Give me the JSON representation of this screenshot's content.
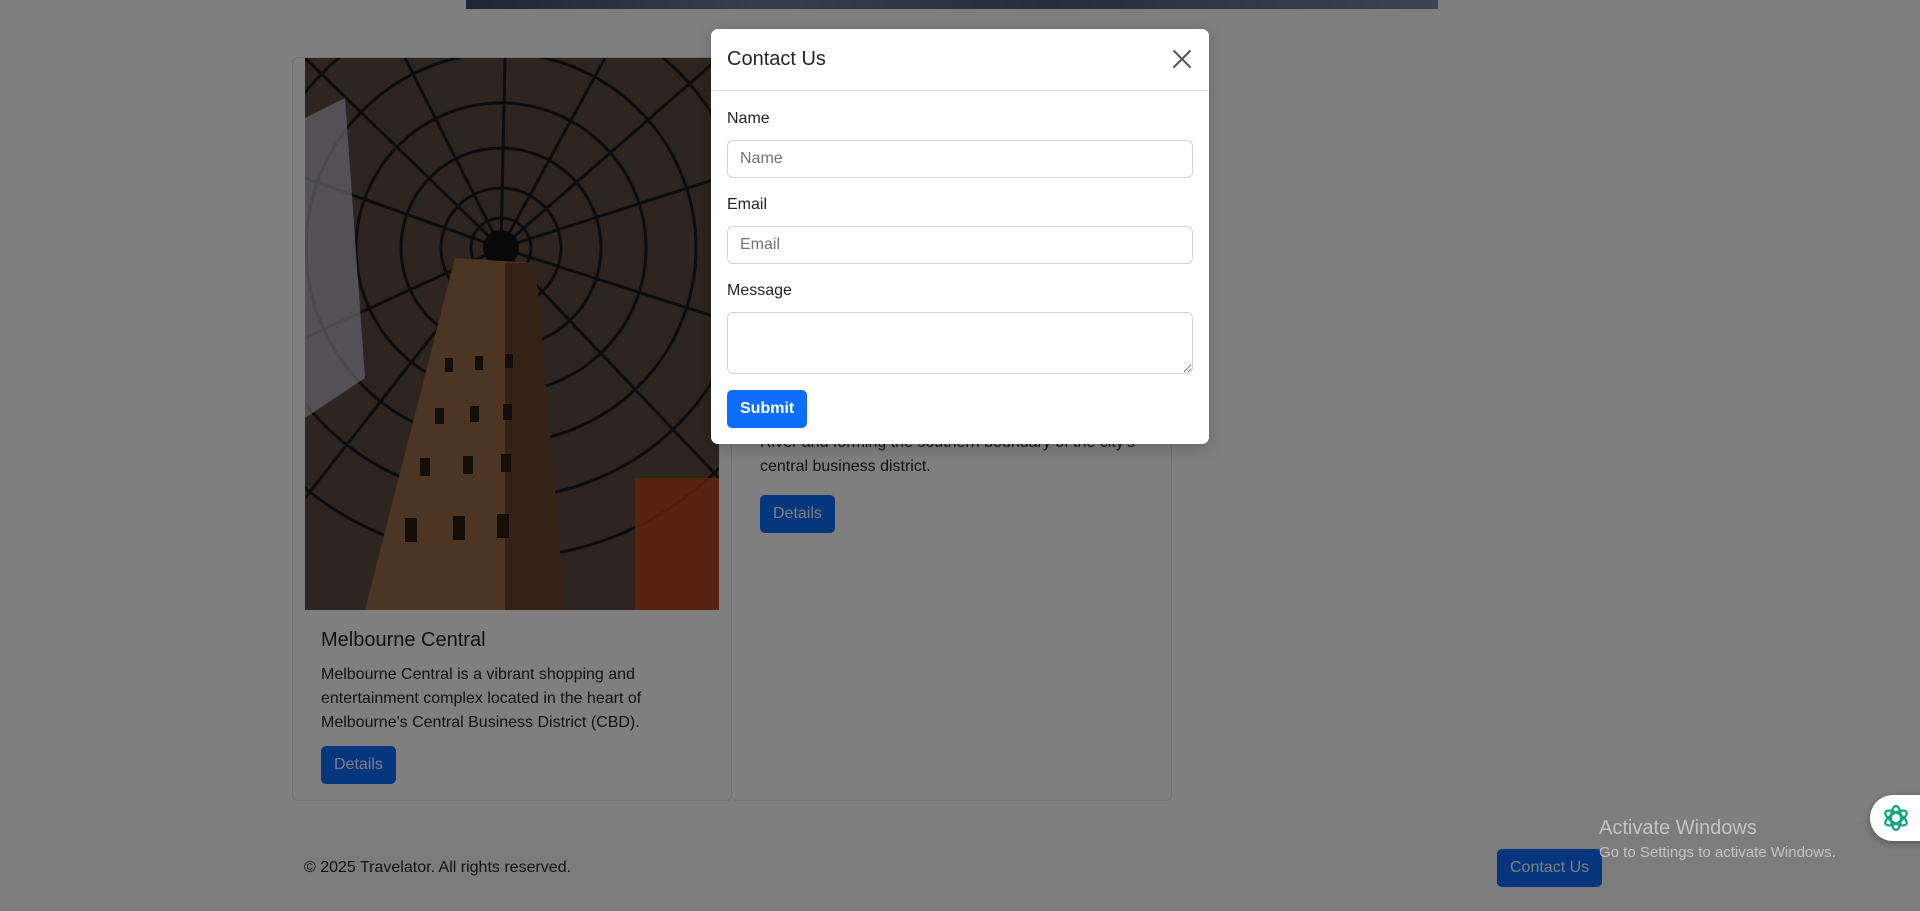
{
  "cards": [
    {
      "title": "Melbourne Central",
      "text": "Melbourne Central is a vibrant shopping and entertainment complex located in the heart of Melbourne's Central Business District (CBD).",
      "button": "Details"
    },
    {
      "text_partial": "River and forming the southern boundary of the city's central business district.",
      "button": "Details"
    }
  ],
  "footer": {
    "copyright": "© 2025 Travelator. All rights reserved.",
    "contact_button": "Contact Us"
  },
  "modal": {
    "title": "Contact Us",
    "name_label": "Name",
    "name_placeholder": "Name",
    "email_label": "Email",
    "email_placeholder": "Email",
    "message_label": "Message",
    "submit_label": "Submit"
  },
  "watermark": {
    "title": "Activate Windows",
    "subtitle": "Go to Settings to activate Windows."
  },
  "colors": {
    "primary": "#0d6efd",
    "backdrop": "rgba(0,0,0,0.5)",
    "assistant_icon": "#10a37f"
  },
  "icons": {
    "close": "close-icon",
    "assistant": "assistant-icon"
  }
}
